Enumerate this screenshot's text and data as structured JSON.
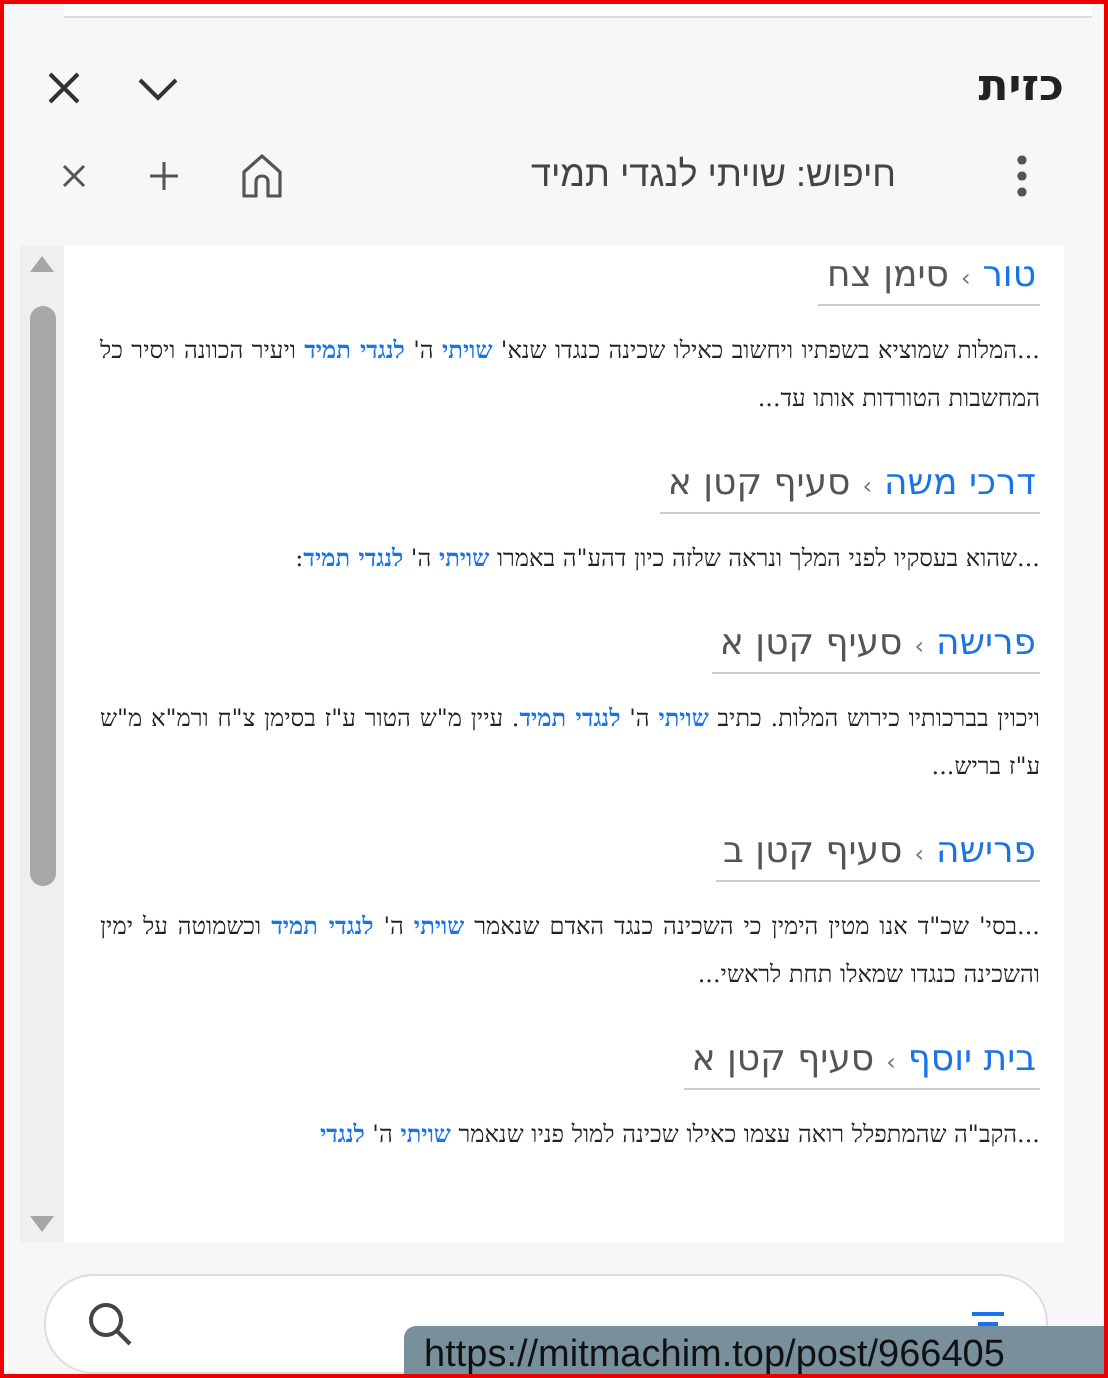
{
  "panel": {
    "title": "כזית"
  },
  "tab": {
    "label": "חיפוש: שויתי לנגדי תמיד"
  },
  "results": [
    {
      "book": "טור",
      "separator": "›",
      "section": "סימן צח",
      "snippet": "...המלות שמוציא בשפתיו ויחשוב כאילו שכינה כנגדו שנא' **שויתי** ה' **לנגדי תמיד** ויעיר הכוונה ויסיר כל המחשבות הטורדות אותו עד..."
    },
    {
      "book": "דרכי משה",
      "separator": "›",
      "section": "סעיף קטן א",
      "snippet": "...שהוא בעסקיו לפני המלך ונראה שלזה כיון דהע\"ה באמרו **שויתי** ה' **לנגדי תמיד**:"
    },
    {
      "book": "פרישה",
      "separator": "›",
      "section": "סעיף קטן א",
      "snippet": "ויכוין בברכותיו כירוש המלות. כתיב **שויתי** ה' **לנגדי תמיד**. עיין מ\"ש הטור ע\"ז בסימן צ\"ח ורמ\"א מ\"ש ע\"ז בריש..."
    },
    {
      "book": "פרישה",
      "separator": "›",
      "section": "סעיף קטן ב",
      "snippet": "...בסי' שכ\"ד אנו מטין הימין כי השכינה כנגד האדם שנאמר **שויתי** ה' **לנגדי תמיד** וכשמוטה על ימין והשכינה כנגדו שמאלו תחת לראשי..."
    },
    {
      "book": "בית יוסף",
      "separator": "›",
      "section": "סעיף קטן א",
      "snippet": "...הקב\"ה שהמתפלל רואה עצמו כאילו שכינה למול פניו שנאמר **שויתי** ה' **לנגדי**"
    }
  ],
  "link_tooltip": "https://mitmachim.top/post/966405"
}
